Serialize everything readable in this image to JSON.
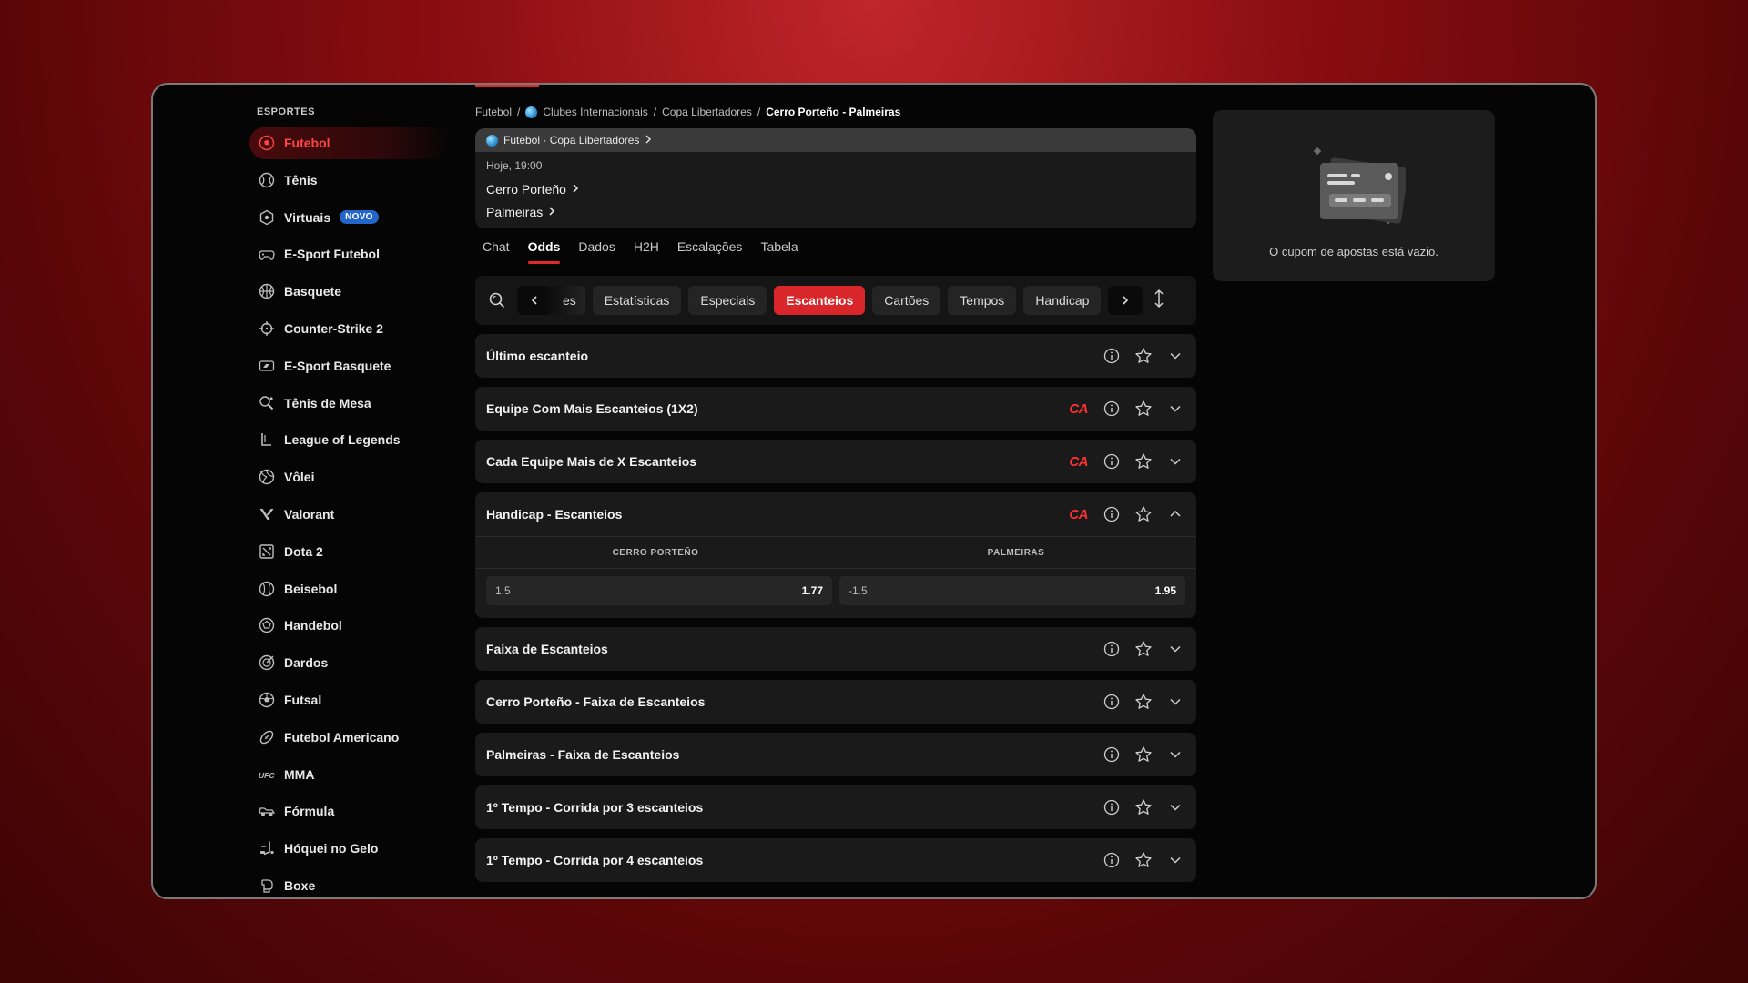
{
  "sidebar": {
    "title": "ESPORTES",
    "items": [
      {
        "label": "Futebol",
        "icon": "soccer-ball-icon",
        "active": true
      },
      {
        "label": "Tênis",
        "icon": "tennis-ball-icon"
      },
      {
        "label": "Virtuais",
        "icon": "virtual-shield-icon",
        "badge": "NOVO"
      },
      {
        "label": "E-Sport Futebol",
        "icon": "gamepad-icon"
      },
      {
        "label": "Basquete",
        "icon": "basketball-icon"
      },
      {
        "label": "Counter-Strike 2",
        "icon": "crosshair-icon"
      },
      {
        "label": "E-Sport Basquete",
        "icon": "esport-basketball-icon"
      },
      {
        "label": "Tênis de Mesa",
        "icon": "table-tennis-icon"
      },
      {
        "label": "League of Legends",
        "icon": "lol-icon"
      },
      {
        "label": "Vôlei",
        "icon": "volleyball-icon"
      },
      {
        "label": "Valorant",
        "icon": "valorant-icon"
      },
      {
        "label": "Dota 2",
        "icon": "dota-icon"
      },
      {
        "label": "Beisebol",
        "icon": "baseball-icon"
      },
      {
        "label": "Handebol",
        "icon": "handball-icon"
      },
      {
        "label": "Dardos",
        "icon": "darts-icon"
      },
      {
        "label": "Futsal",
        "icon": "futsal-ball-icon"
      },
      {
        "label": "Futebol Americano",
        "icon": "american-football-icon"
      },
      {
        "label": "MMA",
        "icon": "ufc-icon"
      },
      {
        "label": "Fórmula",
        "icon": "race-car-icon"
      },
      {
        "label": "Hóquei no Gelo",
        "icon": "hockey-icon"
      },
      {
        "label": "Boxe",
        "icon": "boxing-glove-icon"
      }
    ]
  },
  "breadcrumb": {
    "items": [
      "Futebol",
      "Clubes Internacionais",
      "Copa Libertadores"
    ],
    "separator": "/",
    "current": "Cerro Porteño - Palmeiras"
  },
  "match": {
    "competition": "Futebol · Copa Libertadores",
    "time": "Hoje, 19:00",
    "home": "Cerro Porteño",
    "away": "Palmeiras"
  },
  "tabs": [
    "Chat",
    "Odds",
    "Dados",
    "H2H",
    "Escalações",
    "Tabela"
  ],
  "active_tab": "Odds",
  "filters": {
    "partial": "es",
    "items": [
      "Estatísticas",
      "Especiais",
      "Escanteios",
      "Cartões",
      "Tempos",
      "Handicap"
    ],
    "active": "Escanteios"
  },
  "markets": [
    {
      "title": "Último escanteio",
      "ca": false
    },
    {
      "title": "Equipe Com Mais Escanteios (1X2)",
      "ca": true
    },
    {
      "title": "Cada Equipe Mais de X Escanteios",
      "ca": true
    }
  ],
  "expanded_market": {
    "title": "Handicap - Escanteios",
    "ca": true,
    "home_header": "CERRO PORTEÑO",
    "away_header": "PALMEIRAS",
    "home_line": "1.5",
    "home_price": "1.77",
    "away_line": "-1.5",
    "away_price": "1.95"
  },
  "markets_after": [
    {
      "title": "Faixa de Escanteios"
    },
    {
      "title": "Cerro Porteño - Faixa de Escanteios"
    },
    {
      "title": "Palmeiras - Faixa de Escanteios"
    },
    {
      "title": "1º Tempo - Corrida por 3 escanteios"
    },
    {
      "title": "1º Tempo - Corrida por 4 escanteios"
    }
  ],
  "ca_label": "CA",
  "betslip": {
    "empty_text": "O cupom de apostas está vazio."
  },
  "colors": {
    "accent": "#d8262a",
    "badge": "#2465c9",
    "ca": "#ff3131"
  }
}
